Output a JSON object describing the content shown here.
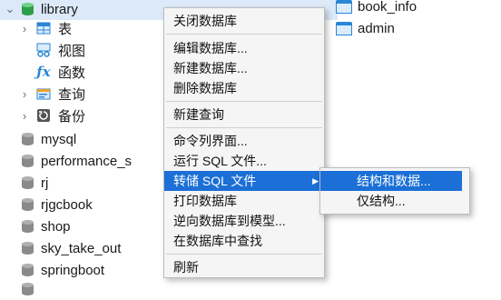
{
  "tree": {
    "root_db": "library",
    "categories": [
      {
        "label": "表",
        "icon": "table-category-icon",
        "expandable": true
      },
      {
        "label": "视图",
        "icon": "view-category-icon",
        "expandable": false
      },
      {
        "label": "函数",
        "icon": "function-category-icon",
        "expandable": false
      },
      {
        "label": "查询",
        "icon": "query-category-icon",
        "expandable": true
      },
      {
        "label": "备份",
        "icon": "backup-category-icon",
        "expandable": true
      }
    ],
    "databases": [
      "mysql",
      "performance_s",
      "rj",
      "rjgcbook",
      "shop",
      "sky_take_out",
      "springboot",
      ""
    ]
  },
  "tables": [
    "book_info",
    "admin"
  ],
  "context_menu": {
    "items": [
      "关闭数据库",
      "编辑数据库...",
      "新建数据库...",
      "删除数据库",
      "新建查询",
      "命令列界面...",
      "运行 SQL 文件...",
      "转储 SQL 文件",
      "打印数据库",
      "逆向数据库到模型...",
      "在数据库中查找",
      "刷新"
    ]
  },
  "submenu": {
    "items": [
      "结构和数据...",
      "仅结构..."
    ]
  },
  "colors": {
    "highlight": "#1b6fd6",
    "active_db": "#2e9e4a",
    "table_icon": "#2a86d6"
  }
}
